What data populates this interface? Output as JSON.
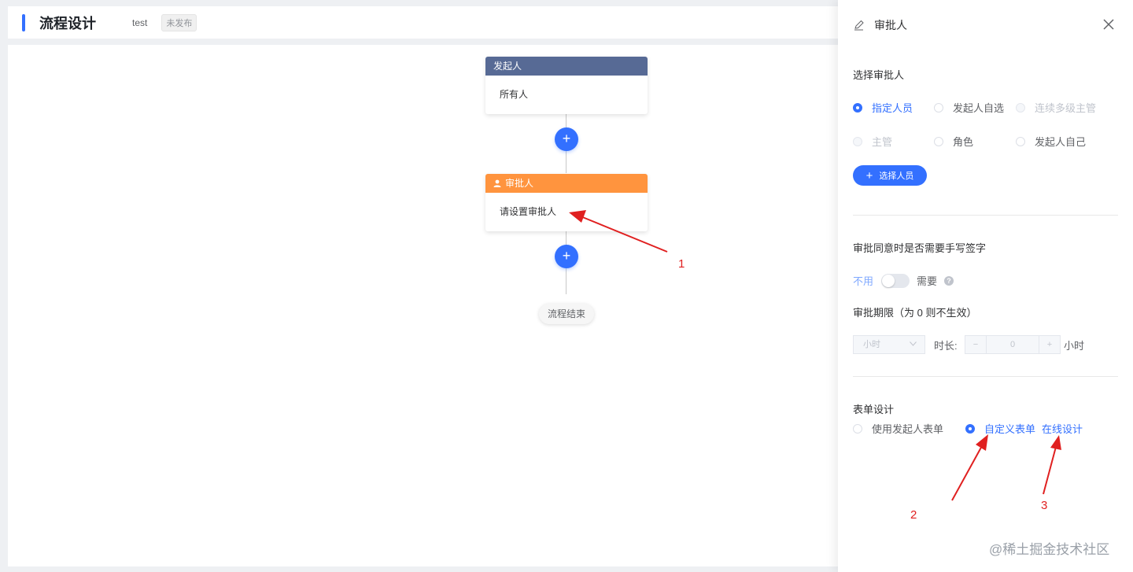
{
  "header": {
    "title": "流程设计",
    "name": "test",
    "status_tag": "未发布"
  },
  "flow": {
    "start_node": {
      "title": "发起人",
      "body": "所有人"
    },
    "approve_node": {
      "title": "审批人",
      "body": "请设置审批人"
    },
    "add_symbol": "+",
    "end_node": "流程结束"
  },
  "annotations": [
    "1",
    "2",
    "3"
  ],
  "drawer": {
    "title": "审批人",
    "approver_section": {
      "label": "选择审批人",
      "options": [
        {
          "label": "指定人员",
          "state": "checked"
        },
        {
          "label": "发起人自选",
          "state": "normal"
        },
        {
          "label": "连续多级主管",
          "state": "disabled"
        },
        {
          "label": "主管",
          "state": "disabled"
        },
        {
          "label": "角色",
          "state": "normal"
        },
        {
          "label": "发起人自己",
          "state": "normal"
        }
      ],
      "select_button": "选择人员"
    },
    "signature": {
      "label": "审批同意时是否需要手写签字",
      "off_text": "不用",
      "on_text": "需要",
      "help": "?"
    },
    "deadline": {
      "label": "审批期限（为 0 则不生效）",
      "unit_value": "小时",
      "duration_label": "时长:",
      "minus": "−",
      "value": "0",
      "plus": "+",
      "unit_suffix": "小时"
    },
    "form_design": {
      "label": "表单设计",
      "options": [
        {
          "label": "使用发起人表单",
          "state": "normal"
        },
        {
          "label": "自定义表单",
          "state": "checked"
        }
      ],
      "link": "在线设计"
    }
  },
  "watermark": "@稀土掘金技术社区",
  "colors": {
    "primary": "#3370ff",
    "start_node": "#576a95",
    "approve_node": "#ff943e",
    "annotation": "#e02020"
  }
}
